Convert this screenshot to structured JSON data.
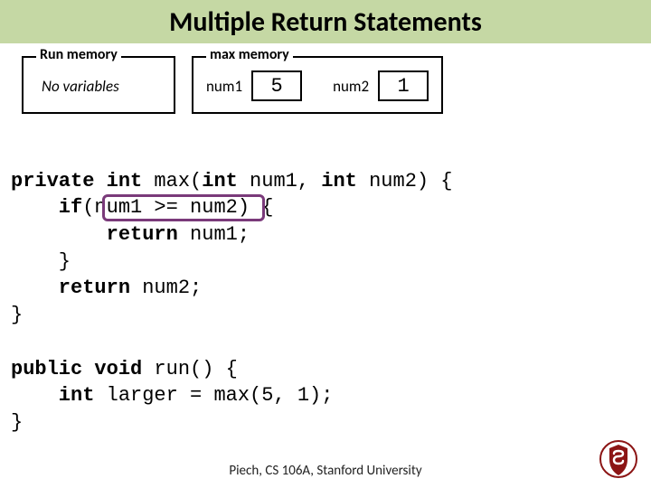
{
  "title": "Multiple Return Statements",
  "memory": {
    "run": {
      "label": "Run memory",
      "text": "No variables"
    },
    "max": {
      "label": "max memory",
      "vars": [
        {
          "name": "num1",
          "value": "5"
        },
        {
          "name": "num2",
          "value": "1"
        }
      ]
    }
  },
  "code": {
    "line1a": "private",
    "line1b": " int",
    "line1c": " max(",
    "line1d": "int",
    "line1e": " num1, ",
    "line1f": "int",
    "line1g": " num2) {",
    "line2a": "    if",
    "line2b": "(num1 >= num2) {",
    "line3a": "        return",
    "line3b": " num1;",
    "line4": "    }",
    "line5a": "    return",
    "line5b": " num2;",
    "line6": "}",
    "blank": "",
    "line7a": "public",
    "line7b": " void",
    "line7c": " run() {",
    "line8a": "    int",
    "line8b": " larger = max(5, 1);",
    "line9": "}"
  },
  "footer": "Piech, CS 106A, Stanford University"
}
